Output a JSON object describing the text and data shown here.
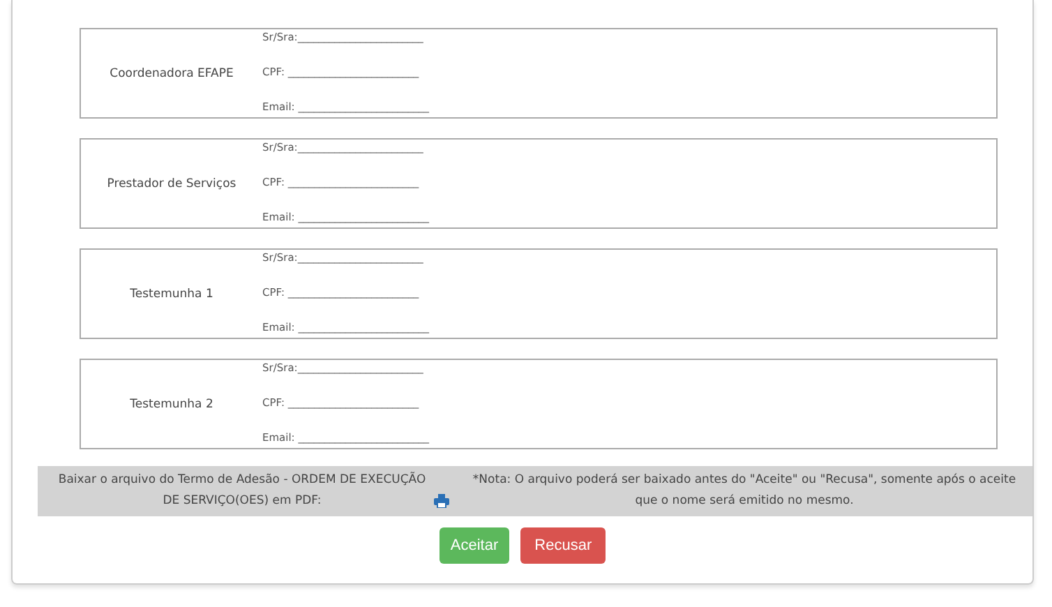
{
  "signers": [
    {
      "role": "Coordenadora EFAPE",
      "fields": [
        "Sr/Sra:________________________",
        "CPF: _________________________",
        "Email: _________________________"
      ]
    },
    {
      "role": "Prestador de Serviços",
      "fields": [
        "Sr/Sra:________________________",
        "CPF: _________________________",
        "Email: _________________________"
      ]
    },
    {
      "role": "Testemunha 1",
      "fields": [
        "Sr/Sra:________________________",
        "CPF: _________________________",
        "Email: _________________________"
      ]
    },
    {
      "role": "Testemunha 2",
      "fields": [
        "Sr/Sra:________________________",
        "CPF: _________________________",
        "Email: _________________________"
      ]
    }
  ],
  "download": {
    "text": "Baixar o arquivo do Termo de Adesão - ORDEM DE EXECUÇÃO DE SERVIÇO(OES) em PDF:",
    "note": "*Nota: O arquivo poderá ser baixado antes do \"Aceite\" ou \"Recusa\", somente após o aceite que o nome será emitido no mesmo."
  },
  "buttons": [
    {
      "label": "Aceitar",
      "kind": "accept"
    },
    {
      "label": "Recusar",
      "kind": "reject"
    }
  ]
}
